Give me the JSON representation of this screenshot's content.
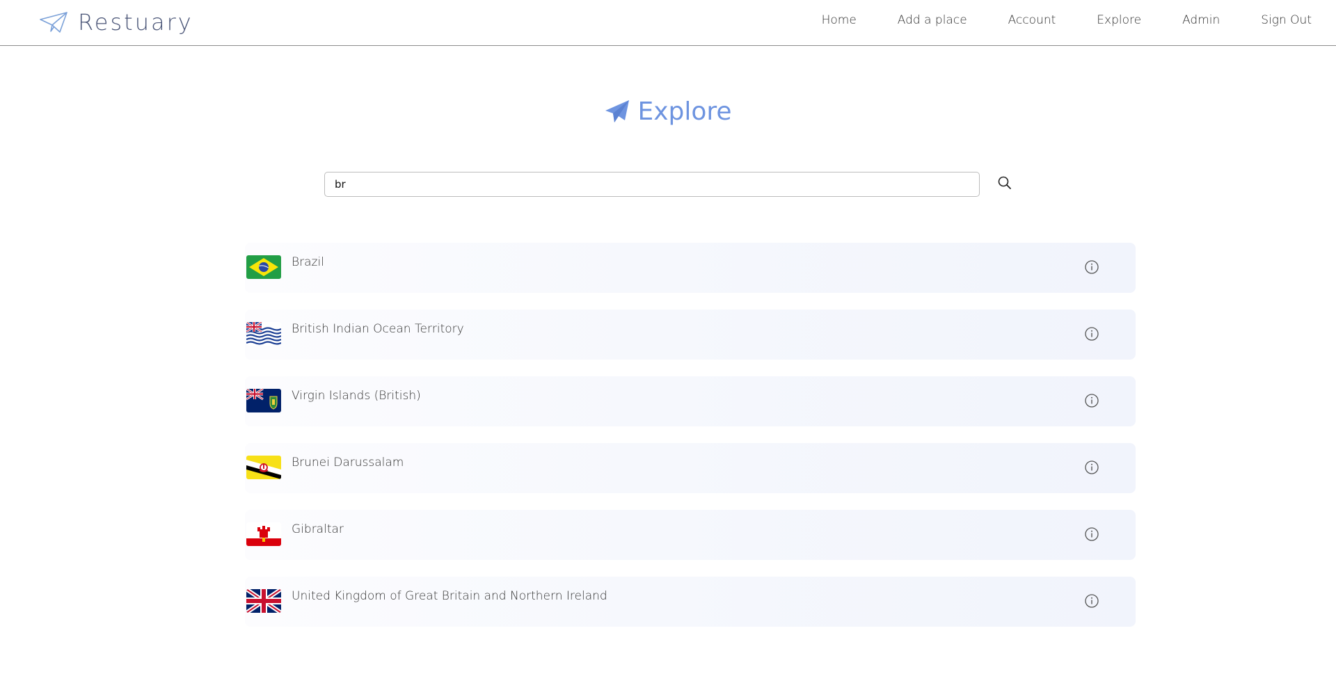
{
  "brand": {
    "name": "Restuary",
    "icon": "paper-plane-outline-icon"
  },
  "nav": [
    {
      "label": "Home"
    },
    {
      "label": "Add a place"
    },
    {
      "label": "Account"
    },
    {
      "label": "Explore"
    },
    {
      "label": "Admin"
    },
    {
      "label": "Sign Out"
    }
  ],
  "page": {
    "title": "Explore",
    "title_icon": "paper-plane-filled-icon",
    "accent_color": "#6e94e0"
  },
  "search": {
    "value": "br",
    "icon": "search-icon"
  },
  "results": [
    {
      "name": "Brazil",
      "flag": "brazil-flag-icon"
    },
    {
      "name": "British Indian Ocean Territory",
      "flag": "biot-flag-icon"
    },
    {
      "name": "Virgin Islands (British)",
      "flag": "bvi-flag-icon"
    },
    {
      "name": "Brunei Darussalam",
      "flag": "brunei-flag-icon"
    },
    {
      "name": "Gibraltar",
      "flag": "gibraltar-flag-icon"
    },
    {
      "name": "United Kingdom of Great Britain and Northern Ireland",
      "flag": "uk-flag-icon"
    }
  ]
}
